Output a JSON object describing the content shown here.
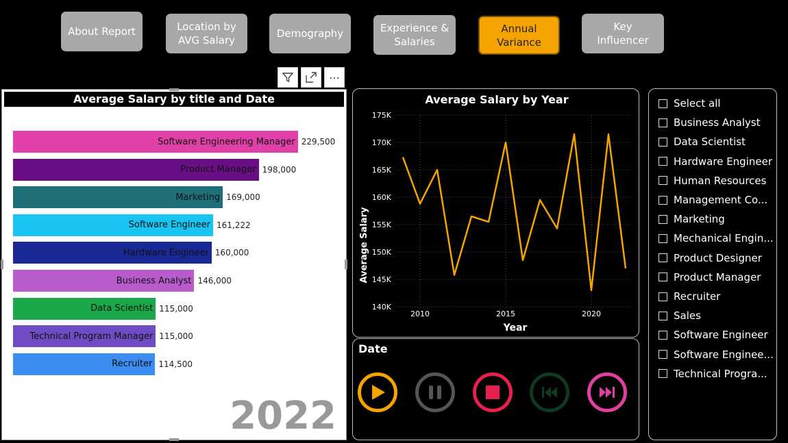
{
  "nav": {
    "buttons": [
      {
        "label": "About Report"
      },
      {
        "label": "Location by\nAVG Salary"
      },
      {
        "label": "Demography"
      },
      {
        "label": "Experience &\nSalaries"
      },
      {
        "label": "Annual Variance",
        "active": true
      },
      {
        "label": "Key Influencer"
      }
    ]
  },
  "toolbar": {
    "filter_icon": "filter-icon",
    "focus_icon": "focus-mode-icon",
    "more_icon": "more-options-icon",
    "more_label": "⋯"
  },
  "bar_visual": {
    "title": "Average Salary by title and Date",
    "year_label": "2022"
  },
  "line_visual": {
    "title": "Average Salary by Year"
  },
  "date_panel": {
    "title": "Date",
    "controls": [
      {
        "name": "play",
        "color": "#f5a300"
      },
      {
        "name": "pause",
        "color": "#555555"
      },
      {
        "name": "stop",
        "color": "#e8204f"
      },
      {
        "name": "previous",
        "color": "#0e3a22"
      },
      {
        "name": "next",
        "color": "#e040a0"
      }
    ]
  },
  "slicer": {
    "items": [
      "Select all",
      "Business Analyst",
      "Data Scientist",
      "Hardware Engineer",
      "Human Resources",
      "Management Co...",
      "Marketing",
      "Mechanical Engin...",
      "Product Designer",
      "Product Manager",
      "Recruiter",
      "Sales",
      "Software Engineer",
      "Software Enginee...",
      "Technical Progra..."
    ]
  },
  "chart_data": [
    {
      "type": "bar",
      "title": "Average Salary by title and Date",
      "categories": [
        "Software Engineering Manager",
        "Product Manager",
        "Marketing",
        "Software Engineer",
        "Hardware Engineer",
        "Business Analyst",
        "Data Scientist",
        "Technical Program Manager",
        "Recruiter"
      ],
      "values": [
        229500,
        198000,
        169000,
        161222,
        160000,
        146000,
        115000,
        115000,
        114500
      ],
      "value_labels": [
        "229,500",
        "198,000",
        "169,000",
        "161,222",
        "160,000",
        "146,000",
        "115,000",
        "115,000",
        "114,500"
      ],
      "colors": [
        "#e040a8",
        "#6a0e86",
        "#1f6f78",
        "#18c4f0",
        "#1a2896",
        "#b85ccc",
        "#1aa84a",
        "#6f4cc4",
        "#3d8cf0"
      ],
      "xlim": [
        0,
        265000
      ]
    },
    {
      "type": "line",
      "title": "Average Salary by Year",
      "xlabel": "Year",
      "ylabel": "Average Salary",
      "x": [
        2009,
        2010,
        2011,
        2012,
        2013,
        2014,
        2015,
        2016,
        2017,
        2018,
        2019,
        2020,
        2021,
        2022
      ],
      "values": [
        167300,
        158800,
        165000,
        145800,
        156500,
        155500,
        170000,
        148500,
        159500,
        154300,
        171500,
        143000,
        171500,
        147000
      ],
      "ylim": [
        140000,
        175000
      ],
      "yticks": [
        140000,
        145000,
        150000,
        155000,
        160000,
        165000,
        170000,
        175000
      ],
      "ytick_labels": [
        "140K",
        "145K",
        "150K",
        "155K",
        "160K",
        "165K",
        "170K",
        "175K"
      ],
      "xticks": [
        2010,
        2015,
        2020
      ],
      "xlim": [
        2008.6,
        2022.4
      ],
      "color": "#f5a300",
      "grid": true
    }
  ]
}
